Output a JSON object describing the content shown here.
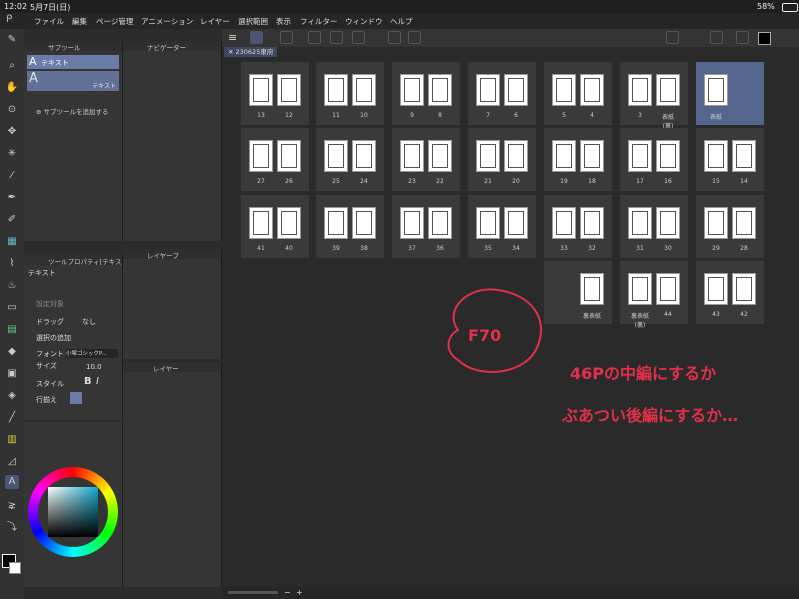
{
  "status": {
    "time": "12:02",
    "date": "5月7日(日)",
    "battery": "58%"
  },
  "menu": [
    "ファイル",
    "編集",
    "ページ管理",
    "アニメーション",
    "レイヤー",
    "選択範囲",
    "表示",
    "フィルター",
    "ウィンドウ",
    "ヘルプ"
  ],
  "subtool": {
    "title": "サブツール",
    "selected": "テキスト",
    "item_label": "テキスト",
    "add_label": "サブツールを追加する"
  },
  "navigator": {
    "title": "ナビゲーター"
  },
  "layer_props": {
    "title": "レイヤープ"
  },
  "layer": {
    "title": "レイヤー"
  },
  "toolprop": {
    "title": "ツールプロパティ[テキス",
    "name": "テキスト",
    "target": "設定対象",
    "drag": "ドラッグ",
    "drag_value": "なし",
    "select_add": "選択の追加",
    "font": "フォント",
    "font_value": "小塚ゴシックP...",
    "size": "サイズ",
    "size_value": "10.0",
    "style": "スタイル",
    "align": "行揃え"
  },
  "document": {
    "tab": "230625東府"
  },
  "rows": [
    [
      [
        "13",
        "12"
      ],
      [
        "11",
        "10"
      ],
      [
        "9",
        "8"
      ],
      [
        "7",
        "6"
      ],
      [
        "5",
        "4"
      ],
      [
        "3",
        "表紙 (裏)"
      ],
      [
        "表紙",
        ""
      ]
    ],
    [
      [
        "27",
        "26"
      ],
      [
        "25",
        "24"
      ],
      [
        "23",
        "22"
      ],
      [
        "21",
        "20"
      ],
      [
        "19",
        "18"
      ],
      [
        "17",
        "16"
      ],
      [
        "15",
        "14"
      ]
    ],
    [
      [
        "41",
        "40"
      ],
      [
        "39",
        "38"
      ],
      [
        "37",
        "36"
      ],
      [
        "35",
        "34"
      ],
      [
        "33",
        "32"
      ],
      [
        "31",
        "30"
      ],
      [
        "29",
        "28"
      ]
    ],
    [
      [
        "",
        "裏表紙"
      ],
      [
        "裏表紙 (裏)",
        "44"
      ],
      [
        "43",
        "42"
      ]
    ]
  ],
  "annotations": {
    "circle": "F70",
    "line1": "46Pの中編にするか",
    "line2": "ぶあつい後編にするか…"
  },
  "colors": {
    "accent": "#6b7ba8",
    "ink": "#e0304a"
  }
}
